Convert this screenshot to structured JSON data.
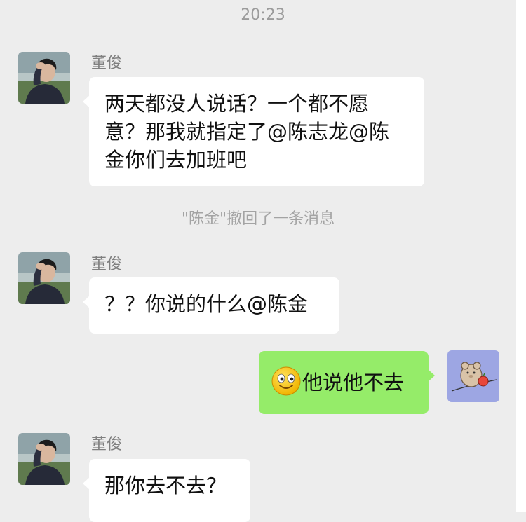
{
  "chat": {
    "timestamp": "20:23",
    "system_notice": "\"陈金\"撤回了一条消息",
    "messages": [
      {
        "sender": "董俊",
        "text": "两天都没人说话？一个都不愿意？那我就指定了@陈志龙@陈金你们去加班吧"
      },
      {
        "sender": "董俊",
        "text": "？？你说的什么@陈金"
      },
      {
        "sender": "me",
        "emoji": "smiling-face-emoji",
        "text": "他说他不去"
      },
      {
        "sender": "董俊",
        "text": "那你去不去？"
      }
    ]
  },
  "colors": {
    "background": "#ededed",
    "bubble_received": "#ffffff",
    "bubble_sent": "#95ec69",
    "avatar_self_bg": "#9da6e3"
  }
}
